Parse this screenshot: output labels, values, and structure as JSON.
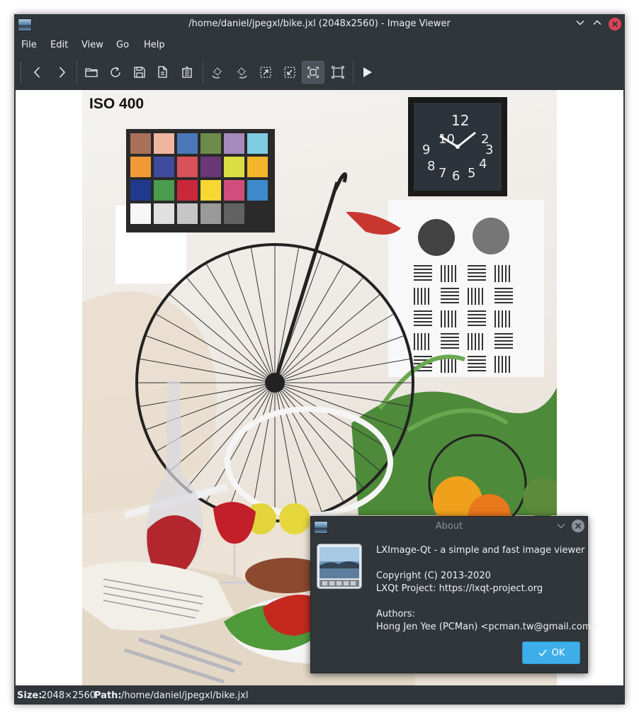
{
  "window": {
    "title": "/home/daniel/jpegxl/bike.jxl (2048x2560) - Image Viewer",
    "controls": [
      "chevron-down-icon",
      "chevron-up-icon",
      "close-icon"
    ]
  },
  "menu": {
    "items": [
      "File",
      "Edit",
      "View",
      "Go",
      "Help"
    ]
  },
  "toolbar": {
    "buttons": [
      "previous-icon",
      "next-icon",
      "open-folder-icon",
      "reload-icon",
      "save-icon",
      "save-as-icon",
      "delete-icon",
      "rotate-clockwise-icon",
      "rotate-counterclockwise-icon",
      "zoom-fit-icon",
      "zoom-original-icon",
      "fit-window-icon",
      "fullscreen-icon",
      "slideshow-icon"
    ],
    "active_button": "fit-window-icon"
  },
  "image": {
    "overlay_text": "ISO 400",
    "checker_colors": [
      "#a9705a",
      "#f0b6a0",
      "#4b79b8",
      "#6d8c4c",
      "#a58bbc",
      "#7fcde0",
      "#f29a36",
      "#3f4c9e",
      "#d9515a",
      "#6a3777",
      "#dcdc44",
      "#f4b52a",
      "#1f3a8c",
      "#4a9c4c",
      "#c9283a",
      "#f7d732",
      "#d04e7c",
      "#3c8acb",
      "#f7f7f7",
      "#e0e0e0",
      "#c6c6c6",
      "#9a9a9a",
      "#626262",
      "#2b2b2b"
    ]
  },
  "about": {
    "title": "About",
    "app_line": "LXImage-Qt - a simple and fast image viewer",
    "copyright": "Copyright (C) 2013-2020",
    "project": "LXQt Project: https://lxqt-project.org",
    "authors_label": "Authors:",
    "author": "Hong Jen Yee (PCMan) <pcman.tw@gmail.com>",
    "ok_label": "OK"
  },
  "status": {
    "size_label": "Size:",
    "size_value": "2048×2560",
    "path_label": "Path:",
    "path_value": "/home/daniel/jpegxl/bike.jxl"
  }
}
